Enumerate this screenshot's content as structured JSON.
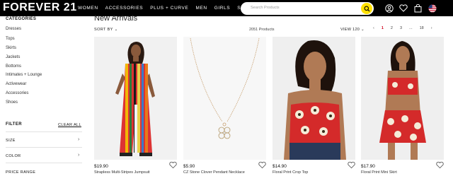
{
  "header": {
    "logo": "FOREVER 21",
    "nav": [
      "WOMEN",
      "ACCESSORIES",
      "PLUS + CURVE",
      "MEN",
      "GIRLS",
      "SALE"
    ],
    "search_placeholder": "Search Products",
    "accent_color": "#ffe000"
  },
  "sidebar": {
    "categories_heading": "CATEGORIES",
    "categories": [
      "Dresses",
      "Tops",
      "Skirts",
      "Jackets",
      "Bottoms",
      "Intimates + Lounge",
      "Activewear",
      "Accessories",
      "Shoes"
    ],
    "filter_heading": "FILTER",
    "clear_all": "CLEAR ALL",
    "facets": [
      "SIZE",
      "COLOR"
    ],
    "price_range": "PRICE RANGE"
  },
  "main": {
    "title": "New Arrivals",
    "sort_label": "SORT BY",
    "product_count": "2051 Products",
    "view_label": "VIEW 120",
    "pages": [
      "1",
      "2",
      "3",
      "...",
      "18"
    ]
  },
  "products": [
    {
      "price": "$19.90",
      "name": "Strapless Multi-Stripes Jumpsuit"
    },
    {
      "price": "$5.90",
      "name": "CZ Stone Clover Pendant Necklace"
    },
    {
      "price": "$14.90",
      "name": "Floral Print Crop Top"
    },
    {
      "price": "$17.90",
      "name": "Floral Print Mini Skirt"
    }
  ]
}
